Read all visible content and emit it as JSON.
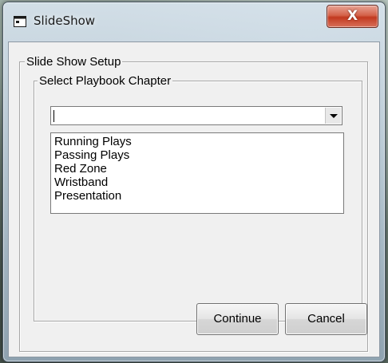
{
  "window": {
    "title": "SlideShow",
    "close_label": "X"
  },
  "frames": {
    "outer_label": "Slide Show Setup",
    "inner_label": "Select Playbook Chapter"
  },
  "combo": {
    "value": ""
  },
  "list": {
    "items": [
      "Running Plays",
      "Passing Plays",
      "Red Zone",
      "Wristband",
      "Presentation"
    ]
  },
  "buttons": {
    "continue_label": "Continue",
    "cancel_label": "Cancel"
  },
  "icons": {
    "title": "window-app-icon",
    "close": "close-icon",
    "dropdown": "chevron-down-icon"
  }
}
